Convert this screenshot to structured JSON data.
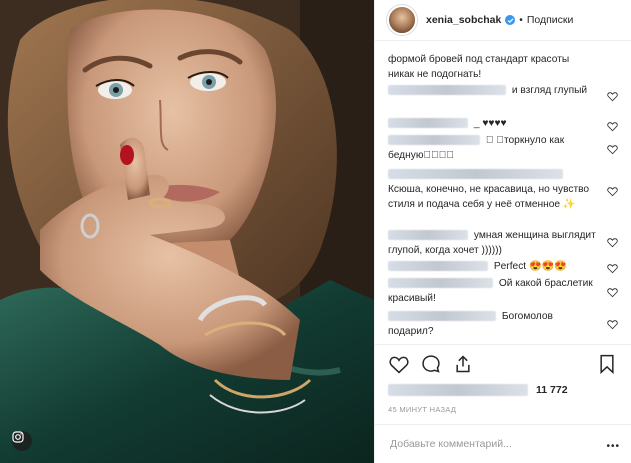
{
  "header": {
    "username": "xenia_sobchak",
    "separator": "•",
    "follow_label": "Подписки"
  },
  "comments": [
    {
      "text": "формой бровей под стандарт красоты никак не подогнать!"
    },
    {
      "text": "и взгляд глупый"
    },
    {
      "text": "_ ♥♥♥♥"
    },
    {
      "text": "⃞ ⃞торкнуло как бедную⃞⃞⃞⃞"
    },
    {
      "text": "Ксюша, конечно, не красавица, но чувство стиля и подача себя у неё отменное ✨"
    },
    {
      "text": "умная женщина выглядит глупой, когда хочет ))))))"
    },
    {
      "text": "Perfect 😍😍😍"
    },
    {
      "text": "Ой какой браслетик красивый!"
    },
    {
      "text": "Богомолов подарил?"
    }
  ],
  "actions": {
    "like_icon": "heart-icon",
    "comment_icon": "comment-icon",
    "share_icon": "share-icon",
    "save_icon": "bookmark-icon"
  },
  "likes_count": "11 772",
  "time_ago": "45 МИНУТ НАЗАД",
  "add_comment": {
    "placeholder": "Добавьте комментарий...",
    "more_label": "•••"
  },
  "colors": {
    "verified": "#3897f0",
    "text": "#262626",
    "muted": "#999999",
    "divider": "#efefef"
  }
}
